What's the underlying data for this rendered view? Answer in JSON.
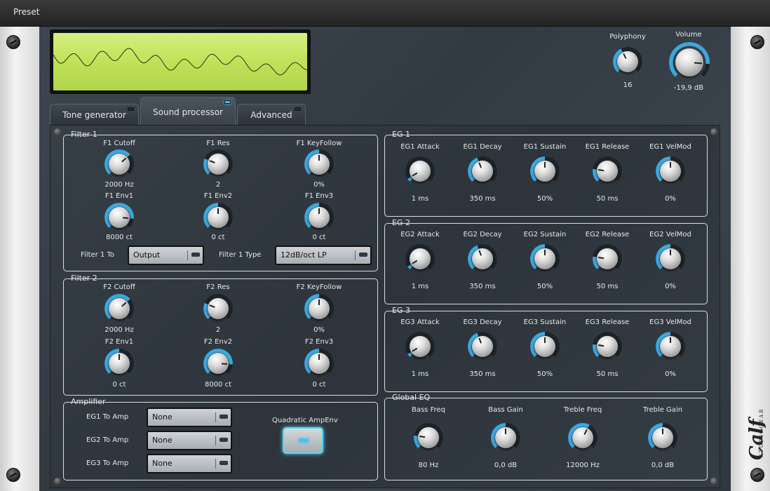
{
  "menu": {
    "preset_label": "Preset"
  },
  "header": {
    "polyphony": {
      "label": "Polyphony",
      "value": "16",
      "level": 0.4
    },
    "volume": {
      "label": "Volume",
      "value": "-19,9 dB",
      "level": 0.85
    }
  },
  "tabs": [
    {
      "label": "Tone generator",
      "active": false
    },
    {
      "label": "Sound processor",
      "active": true
    },
    {
      "label": "Advanced",
      "active": false
    }
  ],
  "filter1": {
    "title": "Filter 1",
    "knobs": [
      {
        "label": "F1 Cutoff",
        "value": "2000 Hz",
        "level": 0.68
      },
      {
        "label": "F1 Res",
        "value": "2",
        "level": 0.25
      },
      {
        "label": "F1 KeyFollow",
        "value": "0%",
        "level": 0.5
      },
      {
        "label": "F1 Env1",
        "value": "8000 ct",
        "level": 0.85
      },
      {
        "label": "F1 Env2",
        "value": "0 ct",
        "level": 0.5
      },
      {
        "label": "F1 Env3",
        "value": "0 ct",
        "level": 0.5
      }
    ],
    "to_label": "Filter 1 To",
    "to_value": "Output",
    "type_label": "Filter 1 Type",
    "type_value": "12dB/oct LP"
  },
  "filter2": {
    "title": "Filter 2",
    "knobs": [
      {
        "label": "F2 Cutoff",
        "value": "2000 Hz",
        "level": 0.68
      },
      {
        "label": "F2 Res",
        "value": "2",
        "level": 0.25
      },
      {
        "label": "F2 KeyFollow",
        "value": "0%",
        "level": 0.5
      },
      {
        "label": "F2 Env1",
        "value": "0 ct",
        "level": 0.5
      },
      {
        "label": "F2 Env2",
        "value": "8000 ct",
        "level": 0.85
      },
      {
        "label": "F2 Env3",
        "value": "0 ct",
        "level": 0.5
      }
    ]
  },
  "amplifier": {
    "title": "Amplifier",
    "rows": [
      {
        "label": "EG1 To Amp",
        "value": "None"
      },
      {
        "label": "EG2 To Amp",
        "value": "None"
      },
      {
        "label": "EG3 To Amp",
        "value": "None"
      }
    ],
    "toggle_label": "Quadratic AmpEnv"
  },
  "eg1": {
    "title": "EG 1",
    "knobs": [
      {
        "label": "EG1 Attack",
        "value": "1 ms",
        "level": 0.05
      },
      {
        "label": "EG1 Decay",
        "value": "350 ms",
        "level": 0.42
      },
      {
        "label": "EG1 Sustain",
        "value": "50%",
        "level": 0.5
      },
      {
        "label": "EG1 Release",
        "value": "50 ms",
        "level": 0.2
      },
      {
        "label": "EG1 VelMod",
        "value": "0%",
        "level": 0.5
      }
    ]
  },
  "eg2": {
    "title": "EG 2",
    "knobs": [
      {
        "label": "EG2 Attack",
        "value": "1 ms",
        "level": 0.05
      },
      {
        "label": "EG2 Decay",
        "value": "350 ms",
        "level": 0.42
      },
      {
        "label": "EG2 Sustain",
        "value": "50%",
        "level": 0.5
      },
      {
        "label": "EG2 Release",
        "value": "50 ms",
        "level": 0.2
      },
      {
        "label": "EG2 VelMod",
        "value": "0%",
        "level": 0.5
      }
    ]
  },
  "eg3": {
    "title": "EG 3",
    "knobs": [
      {
        "label": "EG3 Attack",
        "value": "1 ms",
        "level": 0.05
      },
      {
        "label": "EG3 Decay",
        "value": "350 ms",
        "level": 0.42
      },
      {
        "label": "EG3 Sustain",
        "value": "50%",
        "level": 0.5
      },
      {
        "label": "EG3 Release",
        "value": "50 ms",
        "level": 0.2
      },
      {
        "label": "EG3 VelMod",
        "value": "0%",
        "level": 0.5
      }
    ]
  },
  "eq": {
    "title": "Global EQ",
    "knobs": [
      {
        "label": "Bass Freq",
        "value": "80 Hz",
        "level": 0.2
      },
      {
        "label": "Bass Gain",
        "value": "0,0 dB",
        "level": 0.5
      },
      {
        "label": "Treble Freq",
        "value": "12000 Hz",
        "level": 0.6
      },
      {
        "label": "Treble Gain",
        "value": "0,0 dB",
        "level": 0.5
      }
    ]
  },
  "logo": {
    "brand": "Calf",
    "sub": "STUDIOGEAR"
  },
  "colors": {
    "accent": "#4fb7e8",
    "lcd": "#c2e35c",
    "panel": "#343c44"
  }
}
